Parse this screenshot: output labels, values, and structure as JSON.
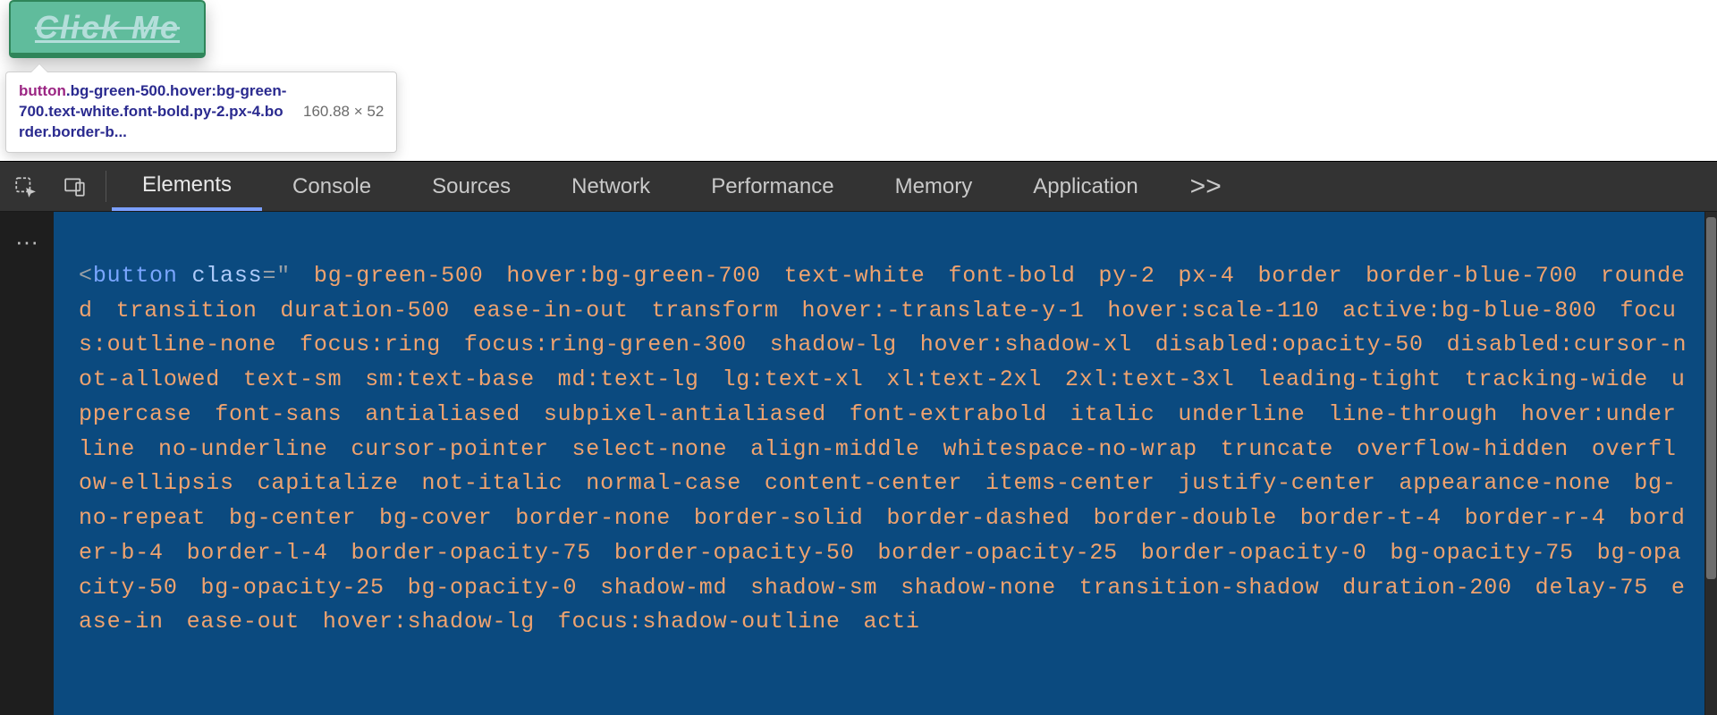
{
  "page": {
    "button_label": "Click Me"
  },
  "tooltip": {
    "tag": "button",
    "selector_rest": ".bg-green-500.hover:bg-green-700.text-white.font-bold.py-2.px-4.border.border-b...",
    "dimensions": "160.88 × 52"
  },
  "devtools": {
    "tabs": [
      "Elements",
      "Console",
      "Sources",
      "Network",
      "Performance",
      "Memory",
      "Application"
    ],
    "active_tab_index": 0,
    "more_label": ">>",
    "gutter": "···",
    "code": {
      "tag": "button",
      "attr": "class",
      "class_string": " bg-green-500 hover:bg-green-700 text-white font-bold py-2 px-4 border border-blue-700 rounded transition duration-500 ease-in-out transform hover:-translate-y-1 hover:scale-110 active:bg-blue-800 focus:outline-none focus:ring focus:ring-green-300 shadow-lg hover:shadow-xl disabled:opacity-50 disabled:cursor-not-allowed text-sm sm:text-base md:text-lg lg:text-xl xl:text-2xl 2xl:text-3xl leading-tight tracking-wide uppercase font-sans antialiased subpixel-antialiased font-extrabold italic underline line-through hover:underline no-underline cursor-pointer select-none align-middle whitespace-no-wrap truncate overflow-hidden overflow-ellipsis capitalize not-italic normal-case content-center items-center justify-center appearance-none bg-no-repeat bg-center bg-cover border-none border-solid border-dashed border-double border-t-4 border-r-4 border-b-4 border-l-4 border-opacity-75 border-opacity-50 border-opacity-25 border-opacity-0 bg-opacity-75 bg-opacity-50 bg-opacity-25 bg-opacity-0 shadow-md shadow-sm shadow-none transition-shadow duration-200 delay-75 ease-in ease-out hover:shadow-lg focus:shadow-outline acti"
    }
  }
}
